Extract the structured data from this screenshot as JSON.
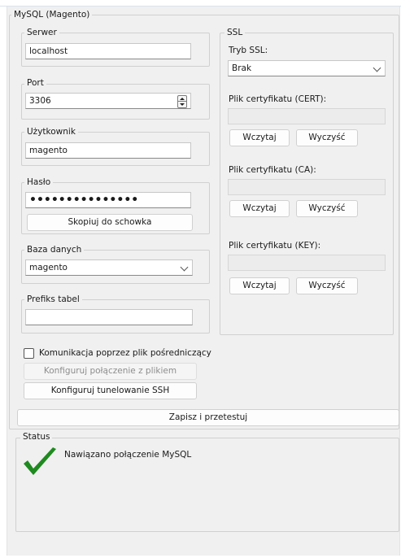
{
  "main_group": {
    "title": "MySQL (Magento)"
  },
  "server": {
    "label": "Serwer",
    "value": "localhost"
  },
  "port": {
    "label": "Port",
    "value": "3306"
  },
  "user": {
    "label": "Użytkownik",
    "value": "magento"
  },
  "password": {
    "label": "Hasło",
    "value": "•••••••••••••••",
    "copy_button": "Skopiuj do schowka"
  },
  "database": {
    "label": "Baza danych",
    "value": "magento"
  },
  "prefix": {
    "label": "Prefiks tabel",
    "value": ""
  },
  "ssl": {
    "title": "SSL",
    "mode_label": "Tryb SSL:",
    "mode_value": "Brak",
    "cert": {
      "label": "Plik certyfikatu (CERT):",
      "value": "",
      "load": "Wczytaj",
      "clear": "Wyczyść"
    },
    "ca": {
      "label": "Plik certyfikatu (CA):",
      "value": "",
      "load": "Wczytaj",
      "clear": "Wyczyść"
    },
    "key": {
      "label": "Plik certyfikatu (KEY):",
      "value": "",
      "load": "Wczytaj",
      "clear": "Wyczyść"
    }
  },
  "proxy_file": {
    "label": "Komunikacja poprzez plik pośredniczący",
    "checked": false
  },
  "buttons": {
    "configure_file": "Konfiguruj połączenie z plikiem",
    "configure_ssh": "Konfiguruj tunelowanie SSH",
    "save_test": "Zapisz i przetestuj"
  },
  "status": {
    "title": "Status",
    "message": "Nawiązano połączenie MySQL",
    "icon": "checkmark-icon",
    "icon_color": "#1f8a1f"
  }
}
